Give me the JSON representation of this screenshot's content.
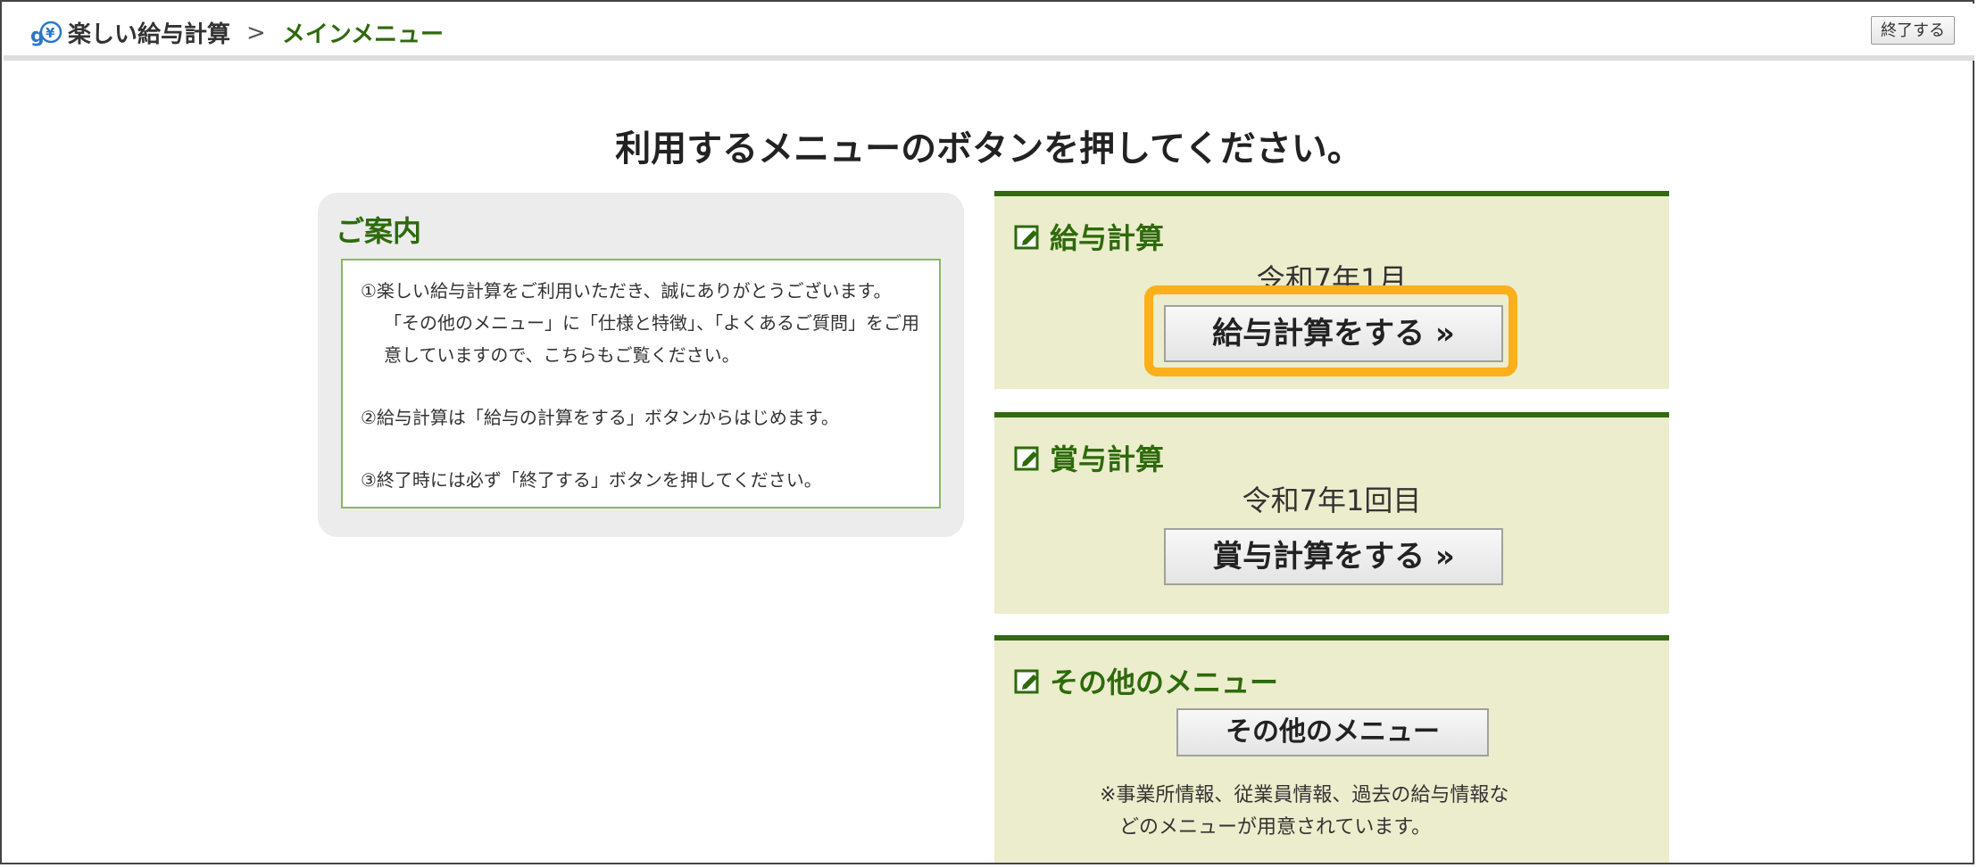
{
  "header": {
    "app_title": "楽しい給与計算",
    "separator": ">",
    "breadcrumb_current": "メインメニュー",
    "quit_label": "終了する",
    "logo_icon": "gy-coin-logo-icon"
  },
  "page_title": "利用するメニューのボタンを押してください。",
  "info": {
    "title": "ご案内",
    "lines": [
      "①楽しい給与計算をご利用いただき、誠にありがとうございます。",
      "「その他のメニュー」に「仕様と特徴」、「よくあるご質問」をご用",
      "意していますので、こちらもご覧ください。",
      "②給与計算は「給与の計算をする」ボタンからはじめます。",
      "③終了時には必ず「終了する」ボタンを押してください。"
    ]
  },
  "panels": {
    "salary": {
      "title": "給与計算",
      "period": "令和7年1月",
      "button_label": "給与計算をする »",
      "icon": "edit-icon"
    },
    "bonus": {
      "title": "賞与計算",
      "period": "令和7年1回目",
      "button_label": "賞与計算をする »",
      "icon": "edit-icon"
    },
    "other": {
      "title": "その他のメニュー",
      "button_label": "その他のメニュー",
      "note_lines": [
        "※事業所情報、従業員情報、過去の給与情報な",
        "どのメニューが用意されています。"
      ],
      "icon": "edit-icon"
    }
  },
  "colors": {
    "accent_green": "#2e6a0c",
    "panel_bg": "#ecedcc",
    "highlight": "#fbb01b"
  }
}
